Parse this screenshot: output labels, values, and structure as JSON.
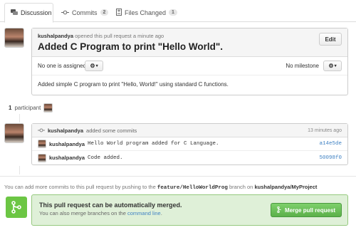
{
  "tabs": [
    {
      "label": "Discussion",
      "icon": "comments-icon"
    },
    {
      "label": "Commits",
      "icon": "commit-icon",
      "count": "2"
    },
    {
      "label": "Files Changed",
      "icon": "diff-icon",
      "count": "1"
    }
  ],
  "discussion": {
    "author": "kushalpandya",
    "action": "opened this pull request a minute ago",
    "title": "Added C Program to print \"Hello World\".",
    "edit_label": "Edit",
    "assignee": "No one is assigned",
    "milestone": "No milestone",
    "body": "Added simple C program to print \"Hello, World!\" using standard C functions."
  },
  "participants": {
    "count": "1",
    "label": "participant"
  },
  "commits": {
    "author": "kushalpandya",
    "action": "added some commits",
    "time": "13 minutes ago",
    "items": [
      {
        "author": "kushalpandya",
        "message": "Hello World program added for C Language.",
        "sha": "a14e5de"
      },
      {
        "author": "kushalpandya",
        "message": "Code added.",
        "sha": "50098f0"
      }
    ]
  },
  "hint": {
    "prefix": "You can add more commits to this pull request by pushing to the",
    "branch": "feature/HelloWorldProg",
    "middle": "branch on",
    "repo": "kushalpandya/MyProject"
  },
  "merge": {
    "title": "This pull request can be automatically merged.",
    "sub_prefix": "You can also merge branches on the",
    "link": "command line",
    "sub_suffix": ".",
    "button": "Merge pull request"
  },
  "colors": {
    "accent_green": "#6cc644",
    "link_blue": "#4183c4"
  }
}
